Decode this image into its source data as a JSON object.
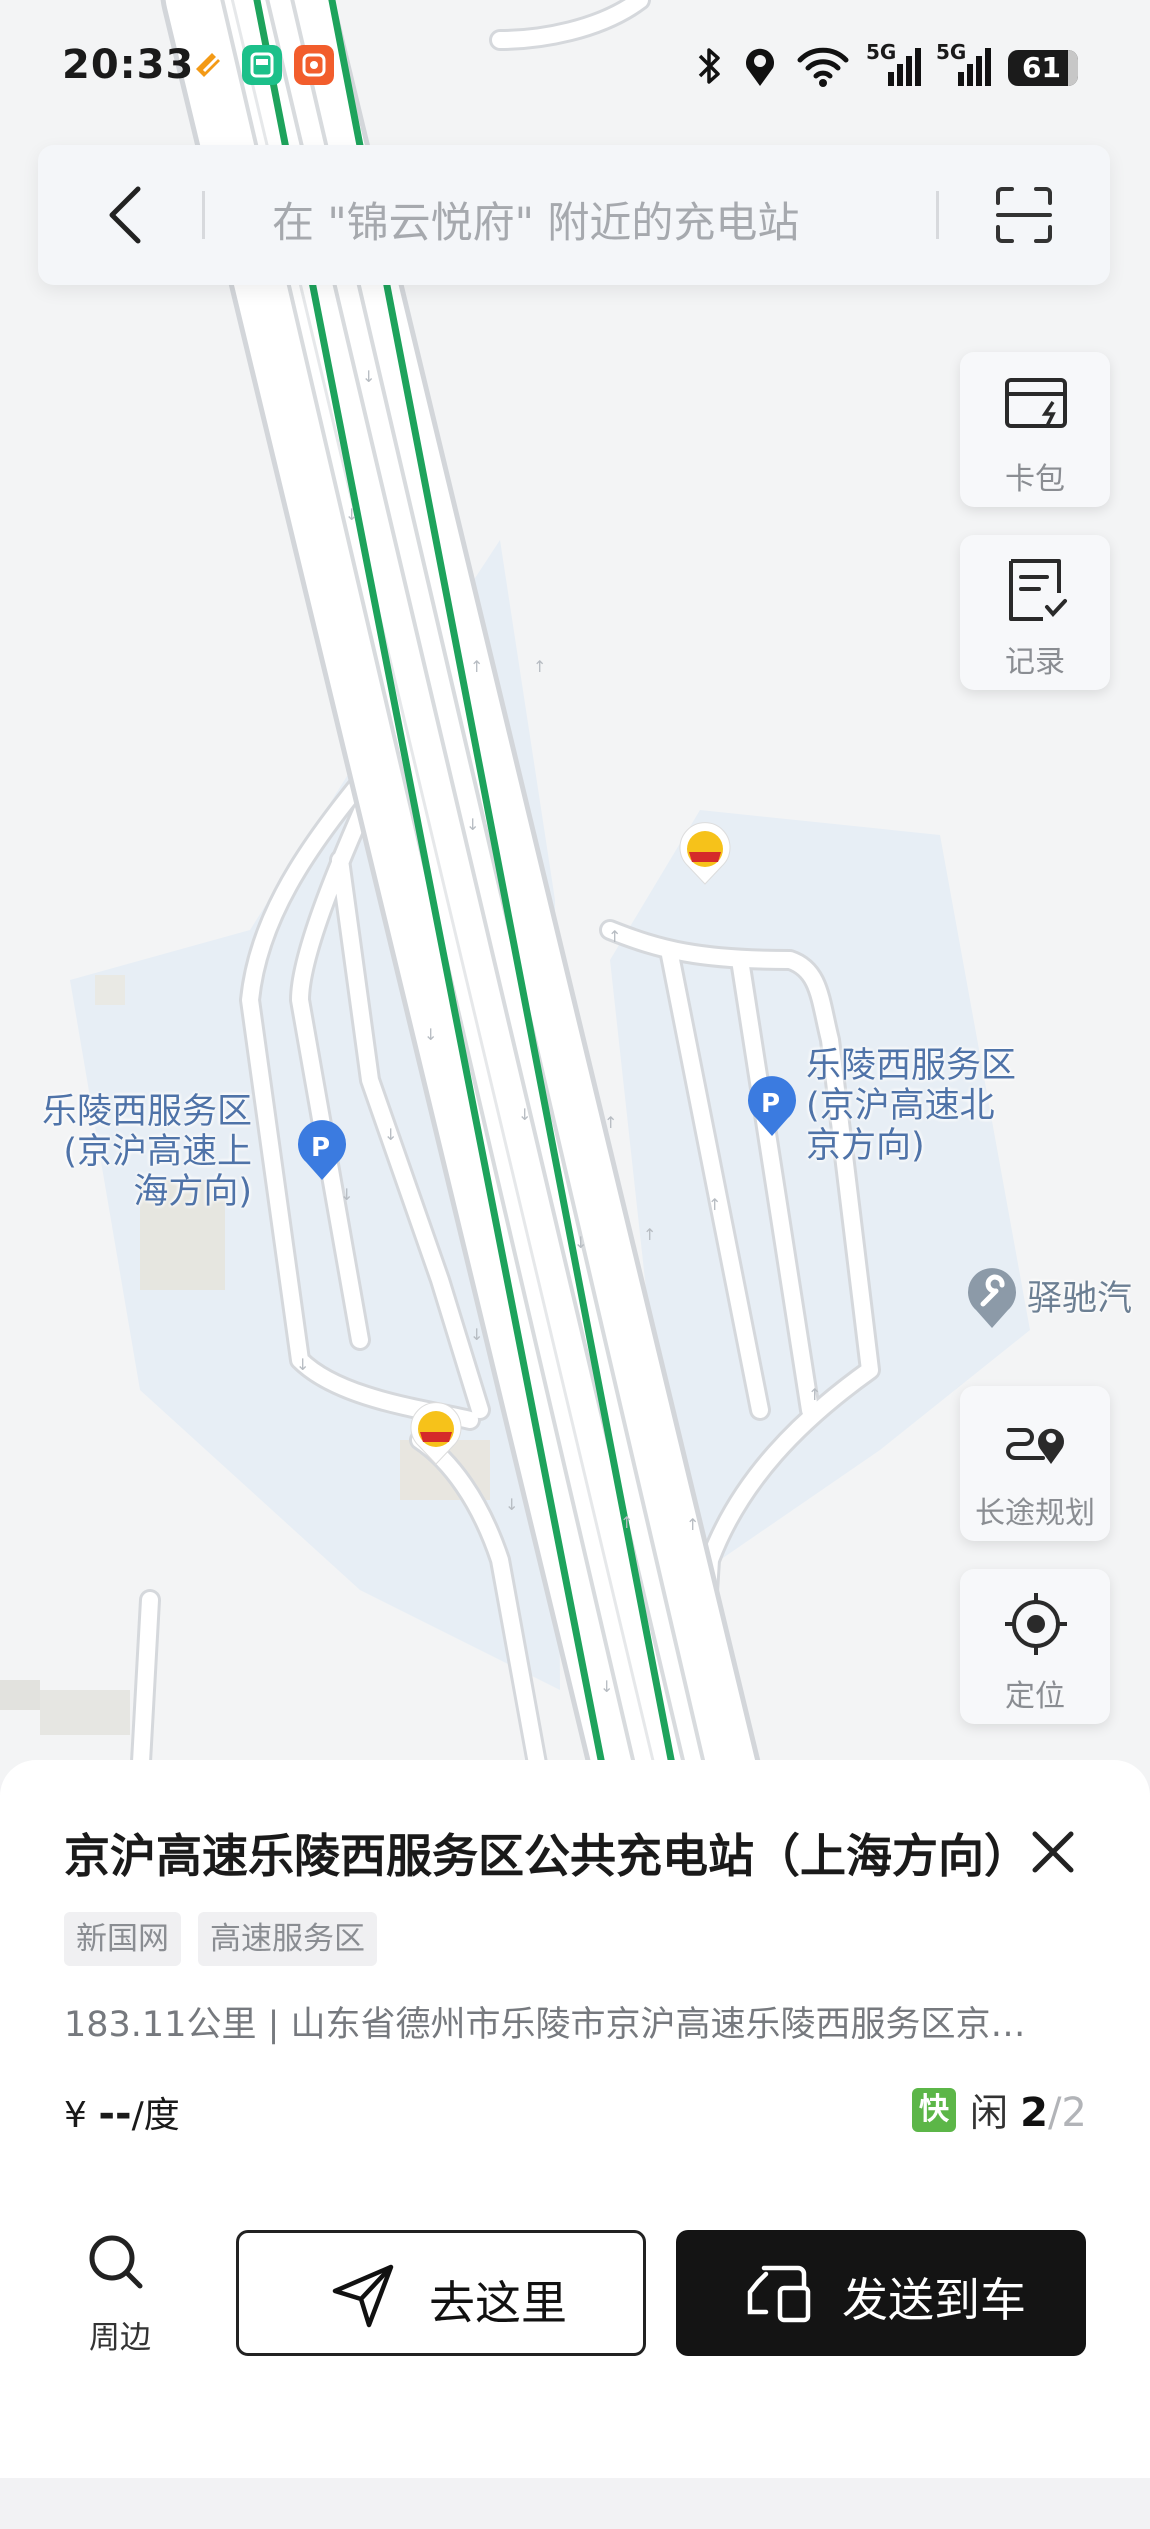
{
  "status_bar": {
    "time": "20:33",
    "network_1": "5G",
    "network_2": "5G",
    "battery": "61"
  },
  "search": {
    "placeholder": "在 \"锦云悦府\" 附近的充电站"
  },
  "side_buttons": {
    "wallet": "卡包",
    "records": "记录",
    "long_trip": "长途规划",
    "locate": "定位"
  },
  "map": {
    "poi_south": "乐陵西服务区\n(京沪高速上\n海方向)",
    "poi_north": "乐陵西服务区\n(京沪高速北\n京方向)",
    "poi_repair": "驿驰汽"
  },
  "station": {
    "title": "京沪高速乐陵西服务区公共充电站（上海方向）",
    "tags": [
      "新国网",
      "高速服务区"
    ],
    "address": "183.11公里 | 山东省德州市乐陵市京沪高速乐陵西服务区京…",
    "price_prefix": "¥",
    "price_value": "--",
    "price_unit": "/度",
    "fast_label": "快",
    "idle_label": "闲",
    "idle_count": "2",
    "total_count": "/2"
  },
  "actions": {
    "nearby": "周边",
    "go_here": "去这里",
    "send_to_car": "发送到车"
  }
}
